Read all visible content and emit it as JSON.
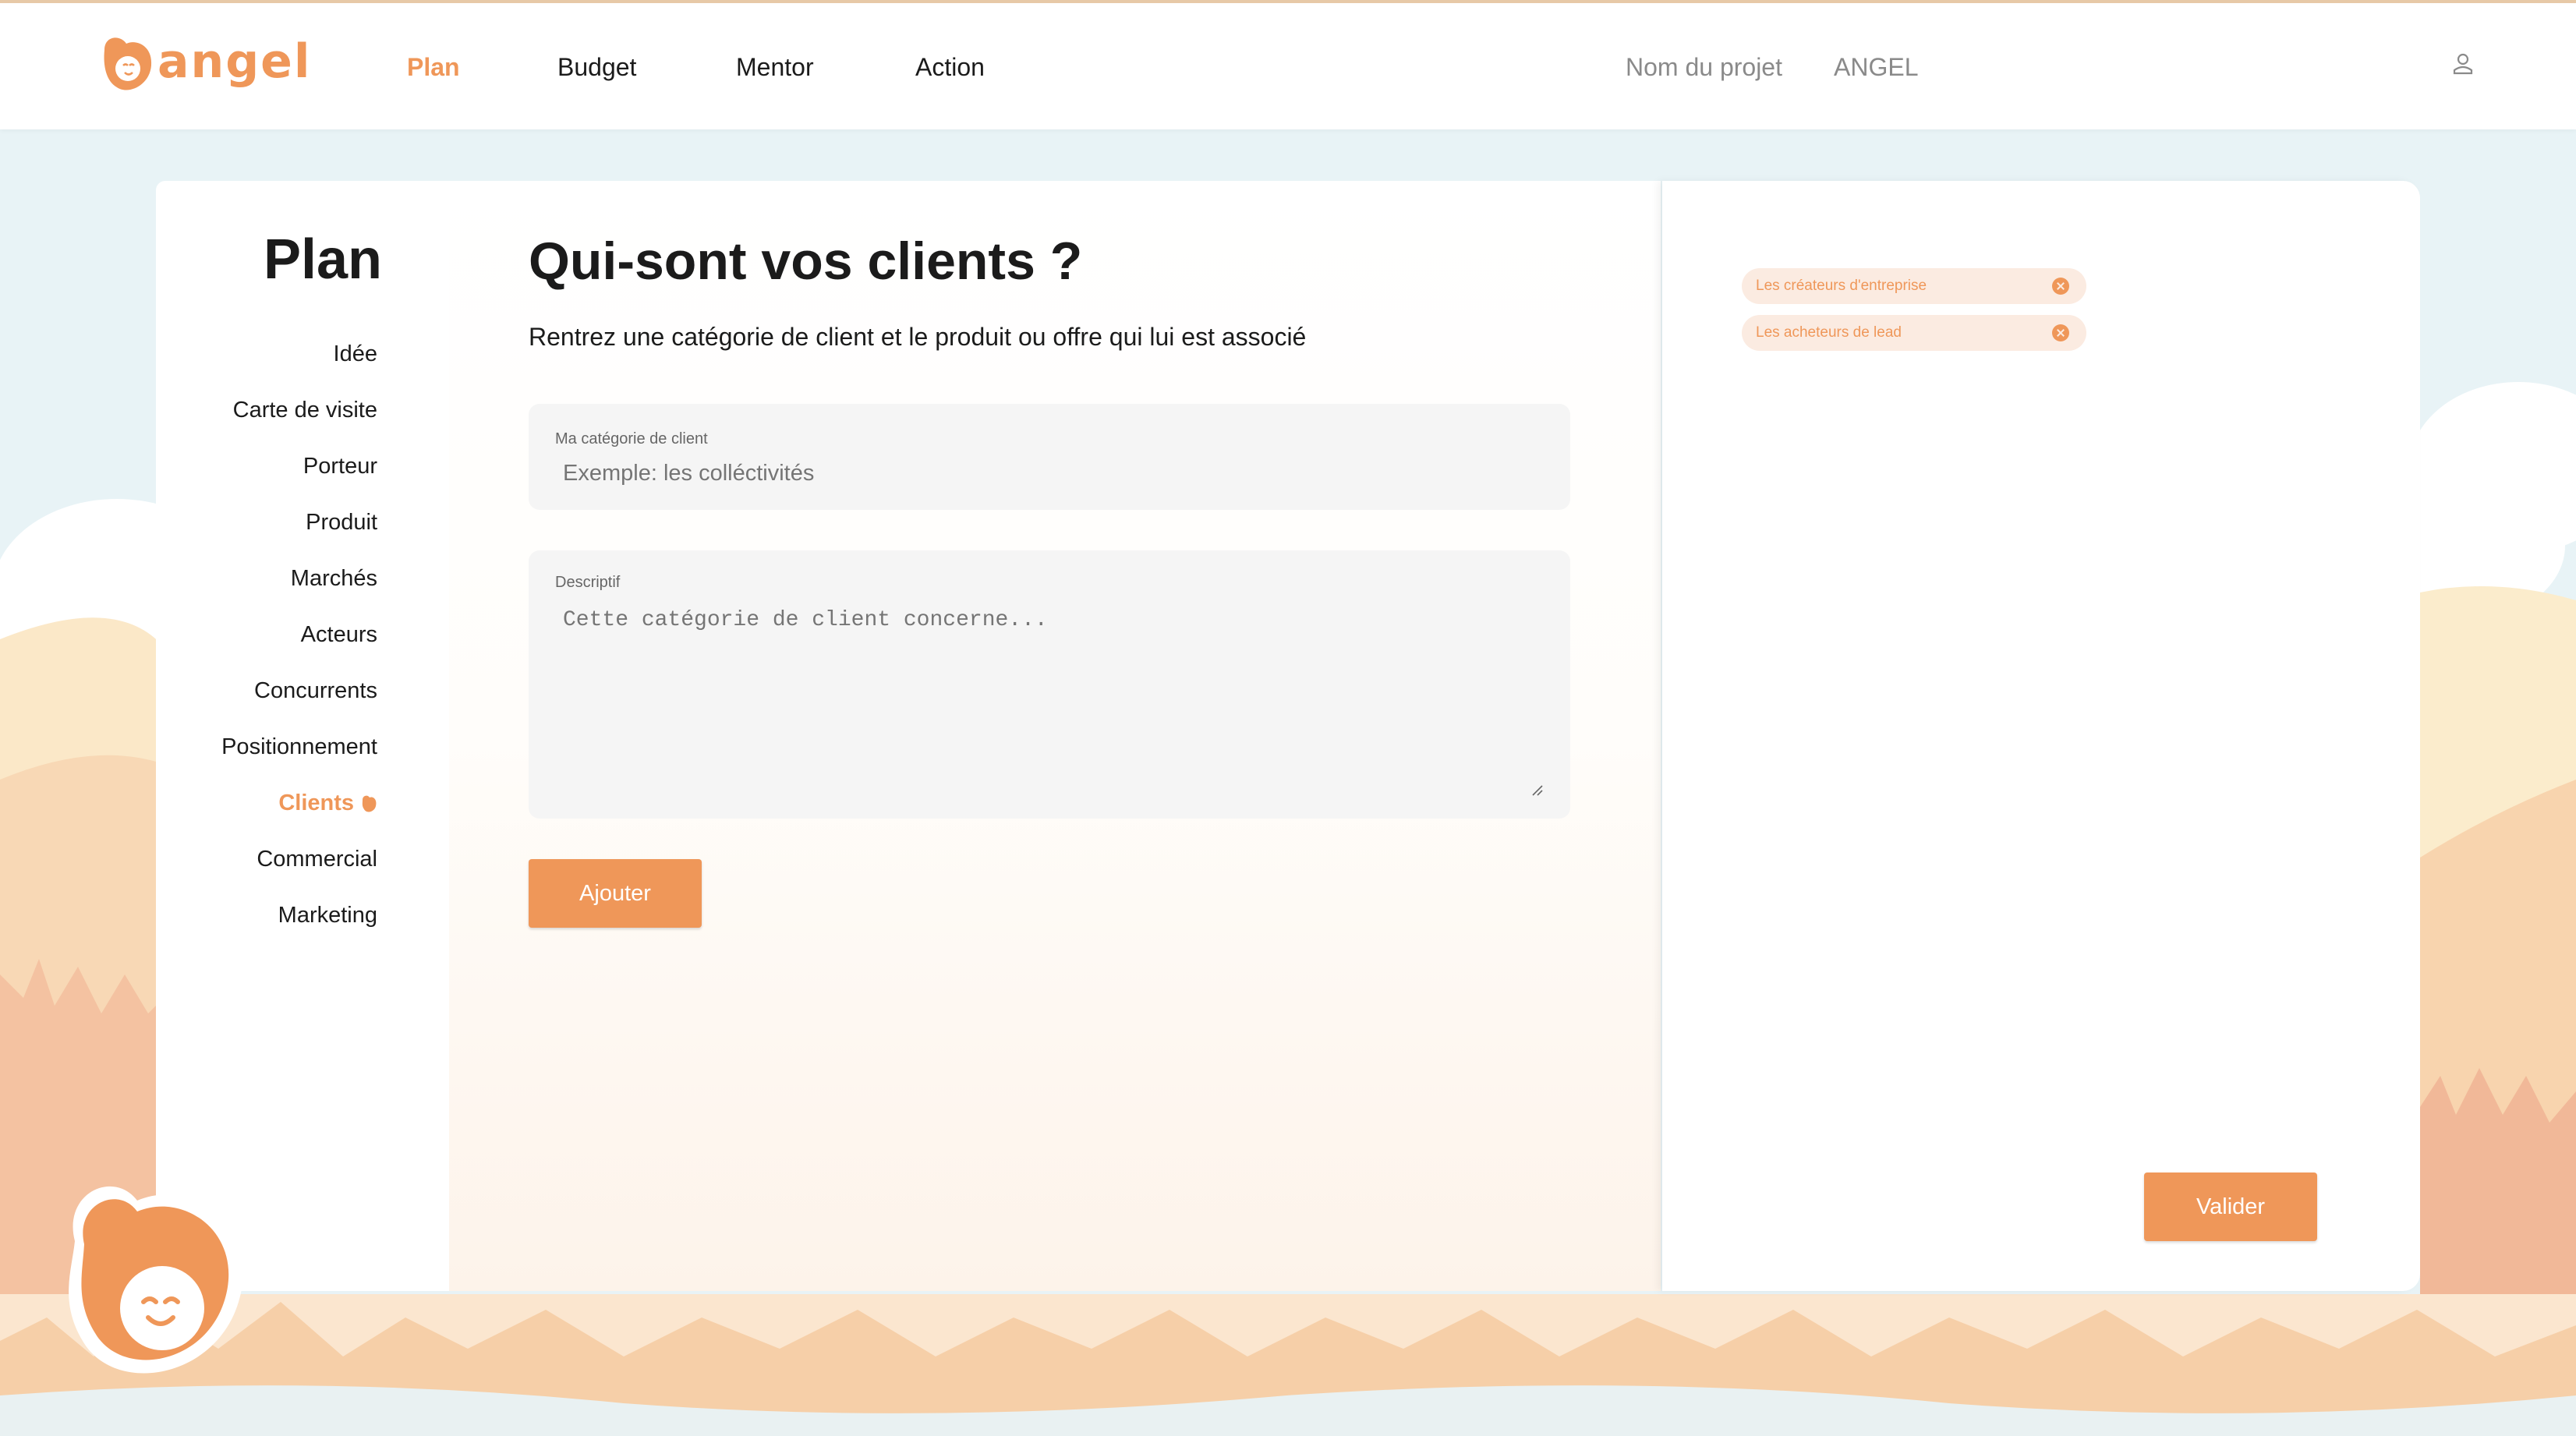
{
  "app": {
    "logo_text": "angel",
    "brand_color": "#ef9759"
  },
  "nav": {
    "items": [
      {
        "label": "Plan",
        "active": true
      },
      {
        "label": "Budget",
        "active": false
      },
      {
        "label": "Mentor",
        "active": false
      },
      {
        "label": "Action",
        "active": false
      }
    ],
    "project_label": "Nom du projet",
    "project_name": "ANGEL",
    "user_icon": "user-icon"
  },
  "sidebar": {
    "title": "Plan",
    "items": [
      {
        "label": "Idée"
      },
      {
        "label": "Carte de visite"
      },
      {
        "label": "Porteur"
      },
      {
        "label": "Produit"
      },
      {
        "label": "Marchés"
      },
      {
        "label": "Acteurs"
      },
      {
        "label": "Concurrents"
      },
      {
        "label": "Positionnement"
      },
      {
        "label": "Clients",
        "active": true
      },
      {
        "label": "Commercial"
      },
      {
        "label": "Marketing"
      }
    ]
  },
  "form": {
    "heading": "Qui-sont vos clients ?",
    "subheading": "Rentrez une catégorie de client et le produit ou offre qui lui est associé",
    "category_label": "Ma catégorie de client",
    "category_placeholder": "Exemple: les colléctivités",
    "description_label": "Descriptif",
    "description_placeholder": "Cette catégorie de client concerne...",
    "add_button": "Ajouter"
  },
  "clients": {
    "tags": [
      {
        "label": "Les créateurs d'entreprise"
      },
      {
        "label": "Les acheteurs de lead"
      }
    ],
    "validate_button": "Valider"
  }
}
